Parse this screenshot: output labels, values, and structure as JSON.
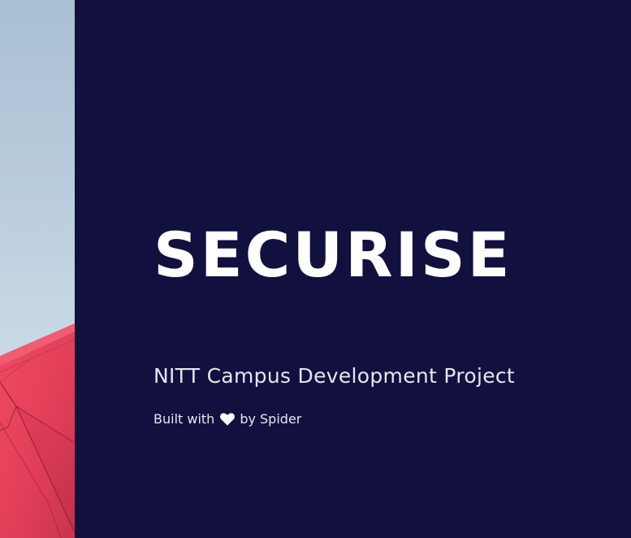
{
  "hero": {
    "title": "SECURISE",
    "subtitle": "NITT Campus Development Project",
    "credit_prefix": "Built with",
    "credit_icon": "heart-icon",
    "credit_suffix": "by Spider"
  },
  "colors": {
    "background": "#11103f",
    "text": "#ffffff",
    "image_sky": "#c3d5e3",
    "image_roof": "#e8495f"
  }
}
